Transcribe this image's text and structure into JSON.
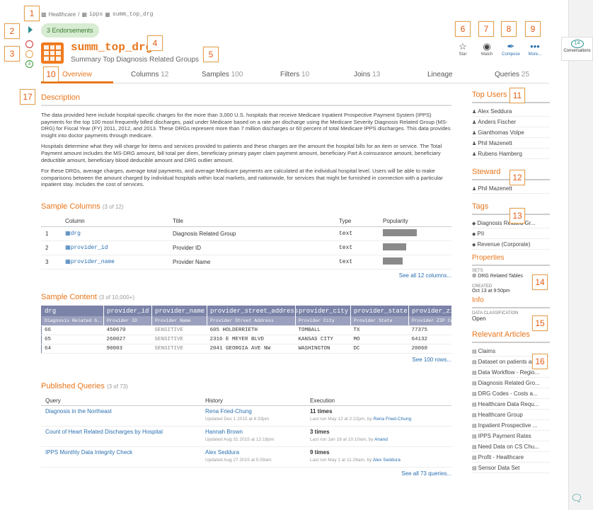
{
  "breadcrumb": {
    "db": "Healthcare",
    "sep": "/",
    "schema": "ipps",
    "table": "summ_top_drg"
  },
  "endorsements": "3 Endorsements",
  "title": "summ_top_drg",
  "subtitle": "Summary Top Diagnosis Related Groups",
  "actions": [
    "Star",
    "Watch",
    "Compose",
    "More..."
  ],
  "counter_badge": "3",
  "callouts": [
    "1",
    "2",
    "3",
    "4",
    "5",
    "6",
    "7",
    "8",
    "9",
    "10",
    "11",
    "12",
    "13",
    "14",
    "15",
    "16",
    "17"
  ],
  "tabs": [
    {
      "label": "Overview",
      "count": ""
    },
    {
      "label": "Columns",
      "count": "12"
    },
    {
      "label": "Samples",
      "count": "100"
    },
    {
      "label": "Filters",
      "count": "10"
    },
    {
      "label": "Joins",
      "count": "13"
    },
    {
      "label": "Lineage",
      "count": ""
    },
    {
      "label": "Queries",
      "count": "25"
    }
  ],
  "description": {
    "heading": "Description",
    "p1": "The data provided here include hospital-specific charges for the more than 3,000 U.S. hospitals that receive Medicare Inpatient Prospective Payment System (IPPS) payments for the top 100 most frequently billed discharges, paid under Medicare based on a rate per discharge using the Medicare Severity Diagnosis Related Group (MS-DRG) for Fiscal Year (FY) 2011, 2012, and 2013. These DRGs represent more than 7 million discharges or 60 percent of total Medicare IPPS discharges. This data provides insight into doctor payments through medicare.",
    "p2": "Hospitals determine what they will charge for items and services provided to patients and these charges are the amount the hospital bills for an item or service. The Total Payment amount includes the MS-DRG amount, bill total per diem, beneficiary primary payer claim payment amount, beneficiary Part A coinsurance amount, beneficiary deductible amount, beneficiary blood deducible amount and DRG outlier amount.",
    "p3": "For these DRGs, average charges, average total payments, and average Medicare payments are calculated at the individual hospital level. Users will be able to make comparisons between the amount charged by individual hospitals within local markets, and nationwide, for services that might be furnished in connection with a particular inpatient stay. Includes the cost of services."
  },
  "sample_columns": {
    "heading": "Sample Columns",
    "sub": "(3 of 12)",
    "headers": [
      "Column",
      "Title",
      "Type",
      "Popularity"
    ],
    "rows": [
      {
        "n": "1",
        "col": "drg",
        "title": "Diagnosis Related Group",
        "type": "text",
        "pop": 0.95
      },
      {
        "n": "2",
        "col": "provider_id",
        "title": "Provider ID",
        "type": "text",
        "pop": 0.65
      },
      {
        "n": "3",
        "col": "provider_name",
        "title": "Provider Name",
        "type": "text",
        "pop": 0.55
      }
    ],
    "see_all": "See all 12 columns..."
  },
  "sample_content": {
    "heading": "Sample Content",
    "sub": "(3 of 10,000+)",
    "headers": [
      "drg",
      "provider_id",
      "provider_name",
      "provider_street_address",
      "provider_city",
      "provider_state",
      "provider_zi"
    ],
    "subheaders": [
      "Diagnosis Related G...",
      "Provider ID",
      "Provider Name",
      "Provider Street Address",
      "Provider City",
      "Provider State",
      "Provider ZIP Co"
    ],
    "rows": [
      [
        "66",
        "450670",
        "SENSITIVE",
        "605 HOLDERRIETH",
        "TOMBALL",
        "TX",
        "77375"
      ],
      [
        "65",
        "260027",
        "SENSITIVE",
        "2316 E MEYER BLVD",
        "KANSAS CITY",
        "MO",
        "64132"
      ],
      [
        "64",
        "90003",
        "SENSITIVE",
        "2041 GEORGIA AVE NW",
        "WASHINGTON",
        "DC",
        "20060"
      ]
    ],
    "see_all": "See 100 rows..."
  },
  "published_queries": {
    "heading": "Published Queries",
    "sub": "(3 of 73)",
    "headers": [
      "Query",
      "History",
      "Execution"
    ],
    "rows": [
      {
        "q": "Diagnosis in the Northeast",
        "who": "Rena Fried-Chung",
        "updated": "Updated Dec 1 2015 at 6:33pm",
        "times": "11 times",
        "last": "Last run May 12 at 2:22pm, by",
        "lastby": "Rena Fried-Chung"
      },
      {
        "q": "Count of Heart Related Discharges by Hospital",
        "who": "Hannah Brown",
        "updated": "Updated Aug 31 2015 at 12:18pm",
        "times": "3 times",
        "last": "Last run Jan 18 at 10:10am, by",
        "lastby": "Anand"
      },
      {
        "q": "IPPS Monthly Data Integrity Check",
        "who": "Alex Seddura",
        "updated": "Updated Aug 27 2015 at 5:59am",
        "times": "9 times",
        "last": "Last run May 1 at 11:26am, by",
        "lastby": "Alex Seddura"
      }
    ],
    "see_all": "See all 73 queries..."
  },
  "sidebar": {
    "top_users": {
      "heading": "Top Users",
      "items": [
        "Alex Seddura",
        "Anders Fischer",
        "Gianthomas Volpe",
        "Phil Mazenett",
        "Rubens Hamberg"
      ]
    },
    "steward": {
      "heading": "Steward",
      "items": [
        "Phil Mazenett"
      ]
    },
    "tags": {
      "heading": "Tags",
      "items": [
        "Diagnosis Related Gr...",
        "PII",
        "Revenue (Corporate)"
      ]
    },
    "properties": {
      "heading": "Properties",
      "sets_label": "SETS",
      "sets_value": "DRG Related Tables",
      "created_label": "CREATED",
      "created_value": "Oct 13 at 9:50pm"
    },
    "info": {
      "heading": "Info",
      "label": "DATA CLASSIFICATION",
      "value": "Open"
    },
    "articles": {
      "heading": "Relevant Articles",
      "items": [
        "Claims",
        "Dataset on patients an...",
        "Data Workflow - Regio...",
        "Diagnosis Related Gro...",
        "DRG Codes - Costs a...",
        "Healthcare Data Requ...",
        "Healthcare Group",
        "Inpatient Prospective ...",
        "IPPS Payment Rates",
        "Need Data on CS Chu...",
        "Profit - Healthcare",
        "Sensor Data Set"
      ]
    }
  },
  "conversations": {
    "count": "14",
    "label": "Conversations"
  }
}
